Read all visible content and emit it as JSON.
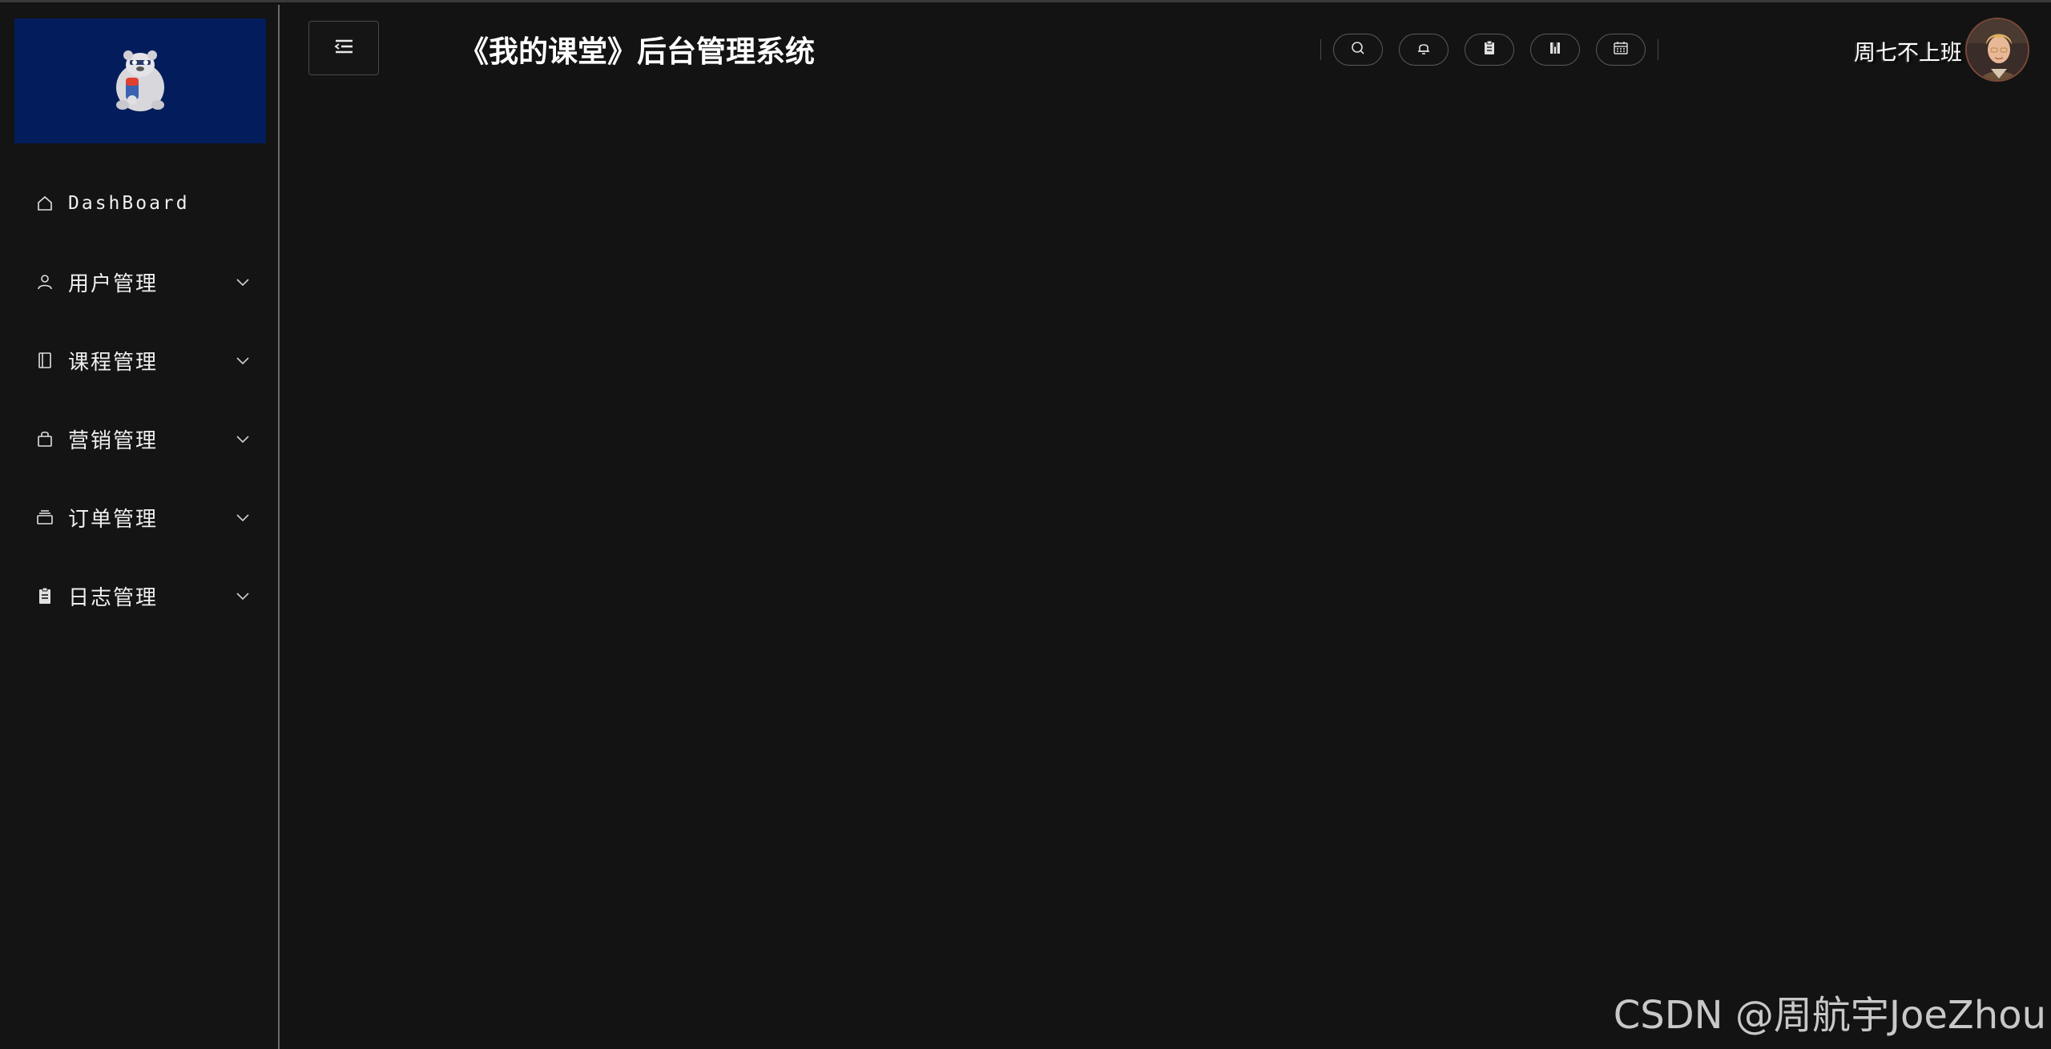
{
  "app": {
    "title": "《我的课堂》后台管理系统",
    "brand_color": "#031d5c"
  },
  "sidebar": {
    "items": [
      {
        "label": "DashBoard",
        "icon": "home-icon",
        "has_submenu": false
      },
      {
        "label": "用户管理",
        "icon": "user-icon",
        "has_submenu": true
      },
      {
        "label": "课程管理",
        "icon": "notebook-icon",
        "has_submenu": true
      },
      {
        "label": "营销管理",
        "icon": "shopping-bag-icon",
        "has_submenu": true
      },
      {
        "label": "订单管理",
        "icon": "box-icon",
        "has_submenu": true
      },
      {
        "label": "日志管理",
        "icon": "clipboard-icon",
        "has_submenu": true
      }
    ]
  },
  "header": {
    "toggle_icon": "fold-menu-icon",
    "tools": [
      {
        "icon": "search-icon"
      },
      {
        "icon": "bell-icon"
      },
      {
        "icon": "clipboard-icon"
      },
      {
        "icon": "book-icon"
      },
      {
        "icon": "calendar-icon"
      }
    ],
    "user": {
      "name": "周七不上班",
      "avatar_icon": "avatar"
    }
  },
  "watermark": {
    "text": "CSDN @周航宇JoeZhou"
  }
}
